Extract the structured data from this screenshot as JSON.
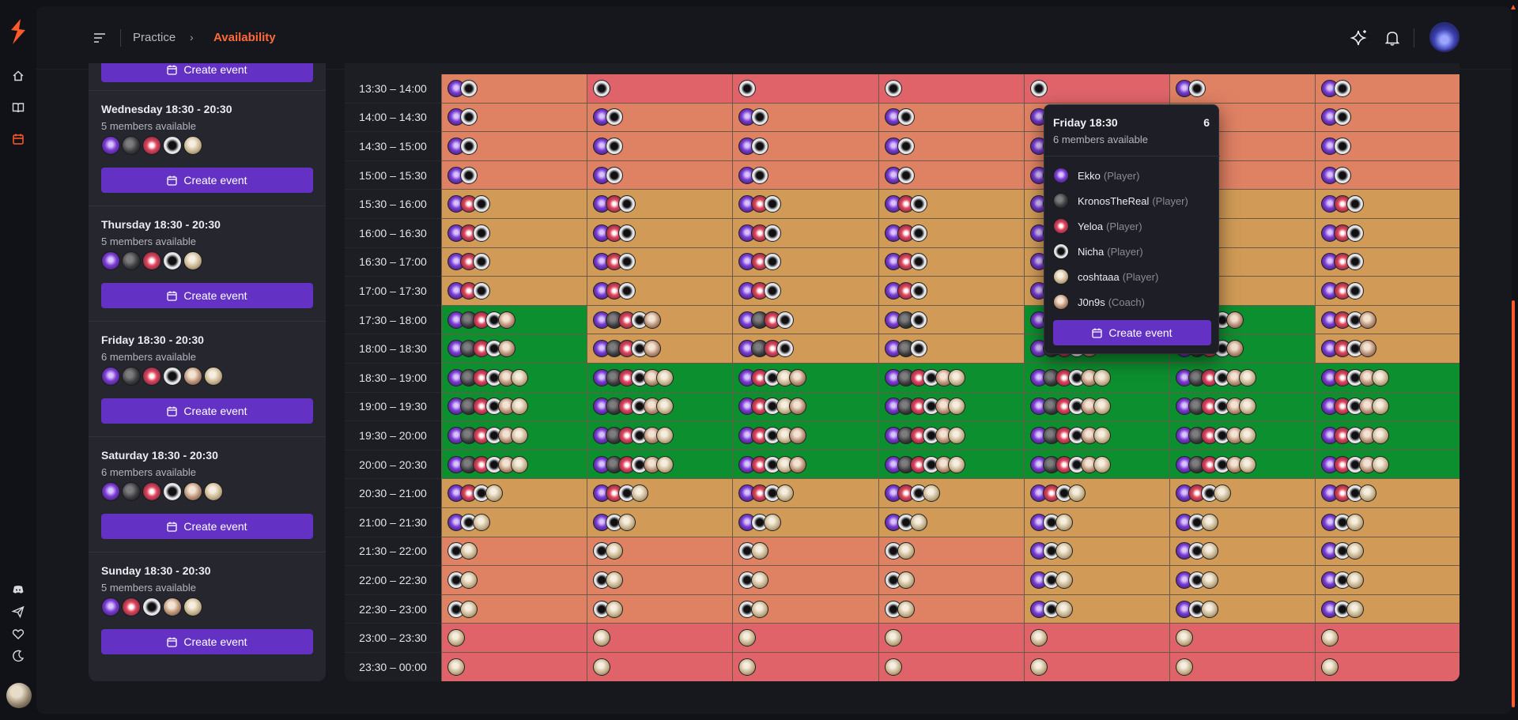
{
  "breadcrumb": {
    "parent": "Practice",
    "separator": "›",
    "current": "Availability"
  },
  "colors": {
    "accent": "#ff5a2a",
    "button": "#6331c4",
    "low": "#e0636a",
    "mid_low": "#df8163",
    "mid": "#d19b57",
    "high": "#0c8f2f"
  },
  "icons": {
    "rail": [
      "home-icon",
      "book-icon",
      "calendar-icon",
      "discord-icon",
      "send-icon",
      "heart-icon",
      "moon-icon"
    ],
    "topbar": [
      "menu-icon",
      "sparkle-icon",
      "bell-icon"
    ]
  },
  "members": {
    "e": "Ekko",
    "k": "KronosTheReal",
    "y": "Yeloa",
    "n": "Nicha",
    "c": "coshtaaa",
    "j": "J0n9s"
  },
  "create_label": "Create event",
  "slots": [
    {
      "title": "",
      "sub": "",
      "avatars": ""
    },
    {
      "title": "Wednesday 18:30 - 20:30",
      "sub": "5 members available",
      "avatars": "ekync"
    },
    {
      "title": "Thursday 18:30 - 20:30",
      "sub": "5 members available",
      "avatars": "ekync"
    },
    {
      "title": "Friday 18:30 - 20:30",
      "sub": "6 members available",
      "avatars": "ekynjc"
    },
    {
      "title": "Saturday 18:30 - 20:30",
      "sub": "6 members available",
      "avatars": "ekynjc"
    },
    {
      "title": "Sunday 18:30 - 20:30",
      "sub": "5 members available",
      "avatars": "eynjc"
    }
  ],
  "grid": {
    "times": [
      "13:30 – 14:00",
      "14:00 – 14:30",
      "14:30 – 15:00",
      "15:00 – 15:30",
      "15:30 – 16:00",
      "16:00 – 16:30",
      "16:30 – 17:00",
      "17:00 – 17:30",
      "17:30 – 18:00",
      "18:00 – 18:30",
      "18:30 – 19:00",
      "19:00 – 19:30",
      "19:30 – 20:00",
      "20:00 – 20:30",
      "20:30 – 21:00",
      "21:00 – 21:30",
      "21:30 – 22:00",
      "22:00 – 22:30",
      "22:30 – 23:00",
      "23:00 – 23:30",
      "23:30 – 00:00"
    ],
    "rows": [
      [
        [
          "mid_low",
          "en"
        ],
        [
          "low",
          "n"
        ],
        [
          "low",
          "n"
        ],
        [
          "low",
          "n"
        ],
        [
          "low",
          "n"
        ],
        [
          "mid_low",
          "en"
        ],
        [
          "mid_low",
          "en"
        ]
      ],
      [
        [
          "mid_low",
          "en"
        ],
        [
          "mid_low",
          "en"
        ],
        [
          "mid_low",
          "en"
        ],
        [
          "mid_low",
          "en"
        ],
        [
          "mid_low",
          "en"
        ],
        [
          "mid_low",
          "en"
        ],
        [
          "mid_low",
          "en"
        ]
      ],
      [
        [
          "mid_low",
          "en"
        ],
        [
          "mid_low",
          "en"
        ],
        [
          "mid_low",
          "en"
        ],
        [
          "mid_low",
          "en"
        ],
        [
          "mid_low",
          "en"
        ],
        [
          "mid_low",
          "en"
        ],
        [
          "mid_low",
          "en"
        ]
      ],
      [
        [
          "mid_low",
          "en"
        ],
        [
          "mid_low",
          "en"
        ],
        [
          "mid_low",
          "en"
        ],
        [
          "mid_low",
          "en"
        ],
        [
          "mid_low",
          "en"
        ],
        [
          "mid_low",
          "en"
        ],
        [
          "mid_low",
          "en"
        ]
      ],
      [
        [
          "mid",
          "eyn"
        ],
        [
          "mid",
          "eyn"
        ],
        [
          "mid",
          "eyn"
        ],
        [
          "mid",
          "eyn"
        ],
        [
          "mid",
          "eyn"
        ],
        [
          "mid",
          "eyn"
        ],
        [
          "mid",
          "eyn"
        ]
      ],
      [
        [
          "mid",
          "eyn"
        ],
        [
          "mid",
          "eyn"
        ],
        [
          "mid",
          "eyn"
        ],
        [
          "mid",
          "eyn"
        ],
        [
          "mid",
          "eyn"
        ],
        [
          "mid",
          "eyn"
        ],
        [
          "mid",
          "eyn"
        ]
      ],
      [
        [
          "mid",
          "eyn"
        ],
        [
          "mid",
          "eyn"
        ],
        [
          "mid",
          "eyn"
        ],
        [
          "mid",
          "eyn"
        ],
        [
          "mid",
          "eyn"
        ],
        [
          "mid",
          "eyn"
        ],
        [
          "mid",
          "eyn"
        ]
      ],
      [
        [
          "mid",
          "eyn"
        ],
        [
          "mid",
          "eyn"
        ],
        [
          "mid",
          "eyn"
        ],
        [
          "mid",
          "eyn"
        ],
        [
          "mid",
          "eyn"
        ],
        [
          "mid",
          "eyn"
        ],
        [
          "mid",
          "eyn"
        ]
      ],
      [
        [
          "high",
          "ekynj"
        ],
        [
          "mid",
          "ekynj"
        ],
        [
          "mid",
          "ekyn"
        ],
        [
          "mid",
          "ekn"
        ],
        [
          "high",
          "ekynj"
        ],
        [
          "high",
          "ekynj"
        ],
        [
          "mid",
          "eynj"
        ]
      ],
      [
        [
          "high",
          "ekynj"
        ],
        [
          "mid",
          "ekynj"
        ],
        [
          "mid",
          "ekyn"
        ],
        [
          "mid",
          "ekn"
        ],
        [
          "high",
          "ekynj"
        ],
        [
          "high",
          "ekynj"
        ],
        [
          "mid",
          "eynj"
        ]
      ],
      [
        [
          "high",
          "ekynjc"
        ],
        [
          "high",
          "ekynjc"
        ],
        [
          "high",
          "eyncj"
        ],
        [
          "high",
          "ekynjc"
        ],
        [
          "high",
          "ekynjc"
        ],
        [
          "high",
          "ekynjc"
        ],
        [
          "high",
          "eynjc"
        ]
      ],
      [
        [
          "high",
          "ekynjc"
        ],
        [
          "high",
          "ekynjc"
        ],
        [
          "high",
          "eyncj"
        ],
        [
          "high",
          "ekynjc"
        ],
        [
          "high",
          "ekynjc"
        ],
        [
          "high",
          "ekynjc"
        ],
        [
          "high",
          "eynjc"
        ]
      ],
      [
        [
          "high",
          "ekynjc"
        ],
        [
          "high",
          "ekynjc"
        ],
        [
          "high",
          "eyncj"
        ],
        [
          "high",
          "ekynjc"
        ],
        [
          "high",
          "ekynjc"
        ],
        [
          "high",
          "ekynjc"
        ],
        [
          "high",
          "eynjc"
        ]
      ],
      [
        [
          "high",
          "ekynjc"
        ],
        [
          "high",
          "ekynjc"
        ],
        [
          "high",
          "eyncj"
        ],
        [
          "high",
          "ekynjc"
        ],
        [
          "high",
          "ekynjc"
        ],
        [
          "high",
          "ekynjc"
        ],
        [
          "high",
          "eynjc"
        ]
      ],
      [
        [
          "mid",
          "eync"
        ],
        [
          "mid",
          "eync"
        ],
        [
          "mid",
          "eync"
        ],
        [
          "mid",
          "eync"
        ],
        [
          "mid",
          "eync"
        ],
        [
          "mid",
          "eync"
        ],
        [
          "mid",
          "eync"
        ]
      ],
      [
        [
          "mid",
          "enc"
        ],
        [
          "mid",
          "enc"
        ],
        [
          "mid",
          "enc"
        ],
        [
          "mid",
          "enc"
        ],
        [
          "mid",
          "enc"
        ],
        [
          "mid",
          "enc"
        ],
        [
          "mid",
          "enc"
        ]
      ],
      [
        [
          "mid_low",
          "nc"
        ],
        [
          "mid_low",
          "nc"
        ],
        [
          "mid_low",
          "nc"
        ],
        [
          "mid_low",
          "nc"
        ],
        [
          "mid",
          "enc"
        ],
        [
          "mid",
          "enc"
        ],
        [
          "mid",
          "enc"
        ]
      ],
      [
        [
          "mid_low",
          "nc"
        ],
        [
          "mid_low",
          "nc"
        ],
        [
          "mid_low",
          "nc"
        ],
        [
          "mid_low",
          "nc"
        ],
        [
          "mid",
          "enc"
        ],
        [
          "mid",
          "enc"
        ],
        [
          "mid",
          "enc"
        ]
      ],
      [
        [
          "mid_low",
          "nc"
        ],
        [
          "mid_low",
          "nc"
        ],
        [
          "mid_low",
          "nc"
        ],
        [
          "mid_low",
          "nc"
        ],
        [
          "mid",
          "enc"
        ],
        [
          "mid",
          "enc"
        ],
        [
          "mid",
          "enc"
        ]
      ],
      [
        [
          "low",
          "c"
        ],
        [
          "low",
          "c"
        ],
        [
          "low",
          "c"
        ],
        [
          "low",
          "c"
        ],
        [
          "low",
          "c"
        ],
        [
          "low",
          "c"
        ],
        [
          "low",
          "c"
        ]
      ],
      [
        [
          "low",
          "c"
        ],
        [
          "low",
          "c"
        ],
        [
          "low",
          "c"
        ],
        [
          "low",
          "c"
        ],
        [
          "low",
          "c"
        ],
        [
          "low",
          "c"
        ],
        [
          "low",
          "c"
        ]
      ]
    ]
  },
  "popover": {
    "title": "Friday 18:30",
    "count": "6",
    "sub": "6 members available",
    "members": [
      {
        "key": "e",
        "name": "Ekko",
        "role": "(Player)"
      },
      {
        "key": "k",
        "name": "KronosTheReal",
        "role": "(Player)"
      },
      {
        "key": "y",
        "name": "Yeloa",
        "role": "(Player)"
      },
      {
        "key": "n",
        "name": "Nicha",
        "role": "(Player)"
      },
      {
        "key": "c",
        "name": "coshtaaa",
        "role": "(Player)"
      },
      {
        "key": "j",
        "name": "J0n9s",
        "role": "(Coach)"
      }
    ],
    "button": "Create event"
  }
}
